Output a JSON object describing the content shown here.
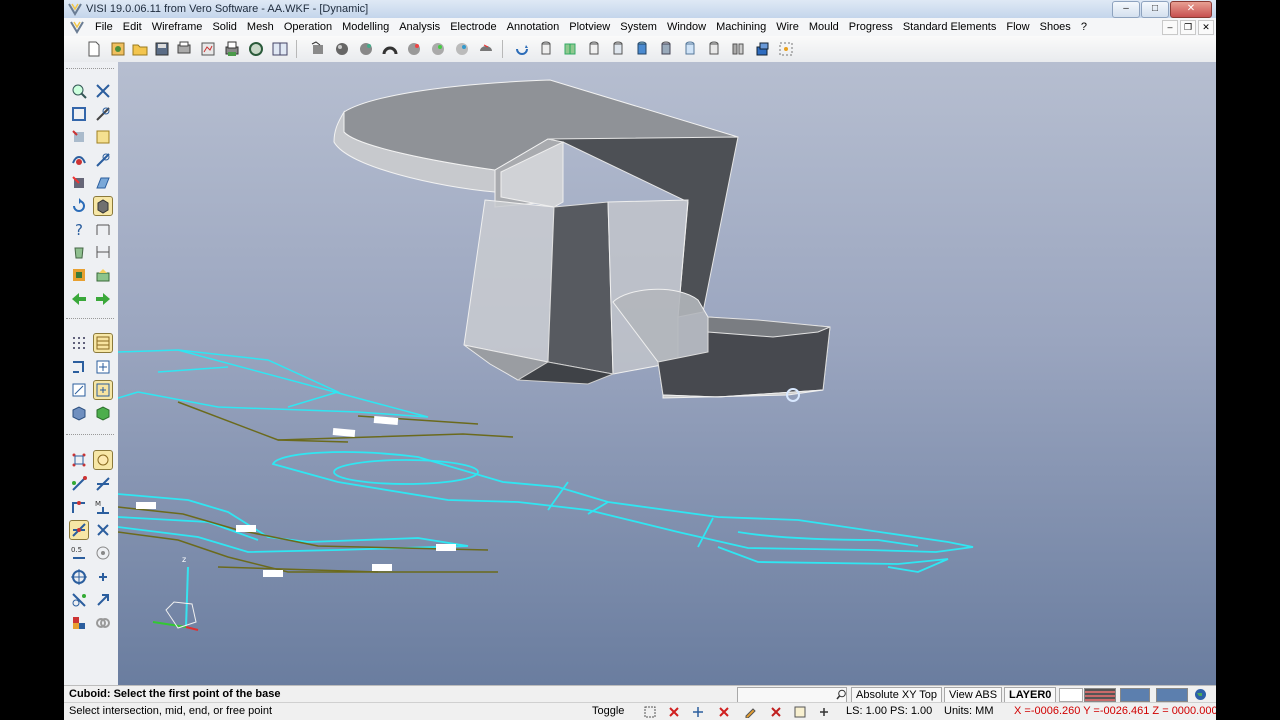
{
  "window": {
    "title": "VISI 19.0.06.11 from Vero Software - AA.WKF - [Dynamic]",
    "min": "–",
    "max": "□",
    "close": "✕"
  },
  "menu": [
    "File",
    "Edit",
    "Wireframe",
    "Solid",
    "Mesh",
    "Operation",
    "Modelling",
    "Analysis",
    "Electrode",
    "Annotation",
    "Plotview",
    "System",
    "Window",
    "Machining",
    "Wire",
    "Mould",
    "Progress",
    "Standard Elements",
    "Flow",
    "Shoes",
    "?"
  ],
  "mdi": {
    "min": "–",
    "restore": "❐",
    "close": "✕"
  },
  "icons": {
    "toolbar": [
      "new-file-icon",
      "open-file-icon",
      "open-folder-icon",
      "save-icon",
      "print-preview-icon",
      "plot-icon",
      "print-icon",
      "zoom-icon",
      "split-view-icon",
      "rotate-view-icon",
      "shade-model-icon",
      "hidden-line-icon",
      "wireframe-view-icon",
      "render-icon",
      "section-view-icon",
      "fly-view-icon",
      "regenerate-icon",
      "cylinder-view-icon",
      "layer-icon",
      "cylinder-grey-icon",
      "cylinder-blue-icon",
      "cylinder-lightblue-icon",
      "cylinder-stack-icon",
      "cylinder-outline-icon",
      "cylinder-double-icon",
      "camera-icon",
      "grid-snap-icon"
    ],
    "palette": [
      "zoom-window-icon",
      "zoom-fit-icon",
      "zoom-extents-icon",
      "pan-icon",
      "rotate-icon",
      "pan-zoom-icon",
      "orbit-icon",
      "shaded-cube-icon",
      "help-icon",
      "measure-icon",
      "delete-icon",
      "properties-icon",
      "group-icon",
      "copy-icon",
      "undo-arrow-icon",
      "redo-arrow-icon",
      "grid-dots-icon",
      "layer-table-icon",
      "workplane-icon",
      "origin-icon",
      "copy-view-icon",
      "move-view-icon",
      "solid-box-icon",
      "solid-green-icon",
      "point-grid-icon",
      "free-hand-icon",
      "snap-endpoint-icon",
      "snap-intersect-icon",
      "snap-midpoint-icon",
      "snap-center-icon",
      "snap-selected-icon",
      "snap-cross-icon",
      "snap-distance-icon",
      "snap-target-icon",
      "snap-circle-icon",
      "snap-plus-icon",
      "snap-tangent-icon",
      "snap-arrows-icon",
      "snap-tools-icon",
      "snap-link-icon"
    ]
  },
  "colors": {
    "wire": "#2fe6f2",
    "dim": "#6b6a1c",
    "solid": "#5b5e63",
    "solid_light": "#d6d8dc"
  },
  "status": {
    "prompt": "Cuboid: Select the first point of the base",
    "hint": "Select intersection, mid, end, or free point",
    "search_placeholder": "",
    "plane": "Absolute XY Top",
    "view": "View ABS",
    "layer": "LAYER0",
    "toggle": "Toggle",
    "ls_ps": "LS: 1.00 PS: 1.00",
    "units": "Units: MM",
    "coords": "X =-0006.260 Y =-0026.461 Z = 0000.000"
  }
}
